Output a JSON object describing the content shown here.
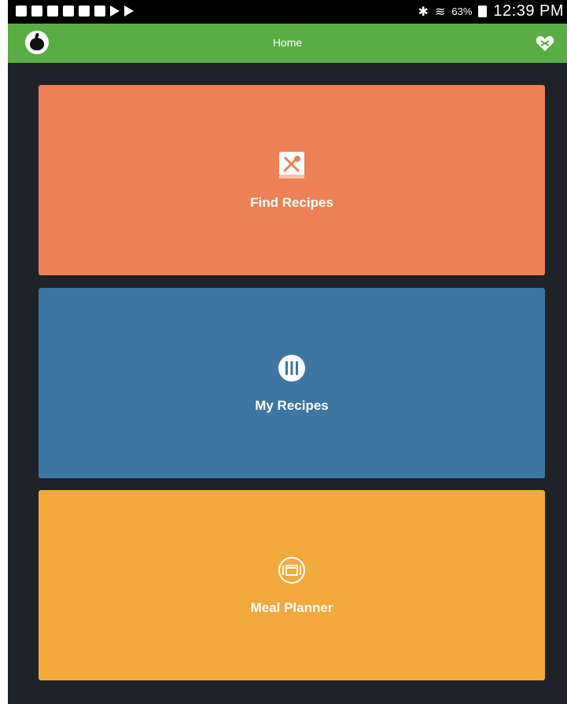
{
  "status_bar": {
    "battery_percent": "63%",
    "time": "12:39 PM",
    "bluetooth_glyph": "✱",
    "wifi_glyph": "≋",
    "icons": [
      "tablet-icon",
      "screen-icon",
      "mail-icon",
      "mail-icon",
      "youtube-icon",
      "image-icon",
      "play-icon",
      "play-icon"
    ]
  },
  "app_bar": {
    "title": "Home",
    "logo_icon": "apple-icon",
    "action_icon": "heart-icon"
  },
  "tiles": [
    {
      "label": "Find Recipes",
      "icon": "recipe-book-icon",
      "color": "#ec8155"
    },
    {
      "label": "My Recipes",
      "icon": "cutlery-icon",
      "color": "#3d76a2"
    },
    {
      "label": "Meal Planner",
      "icon": "meal-planner-icon",
      "color": "#f2aa3c"
    }
  ],
  "colors": {
    "app_bar": "#5aad43",
    "background": "#1f2327"
  }
}
